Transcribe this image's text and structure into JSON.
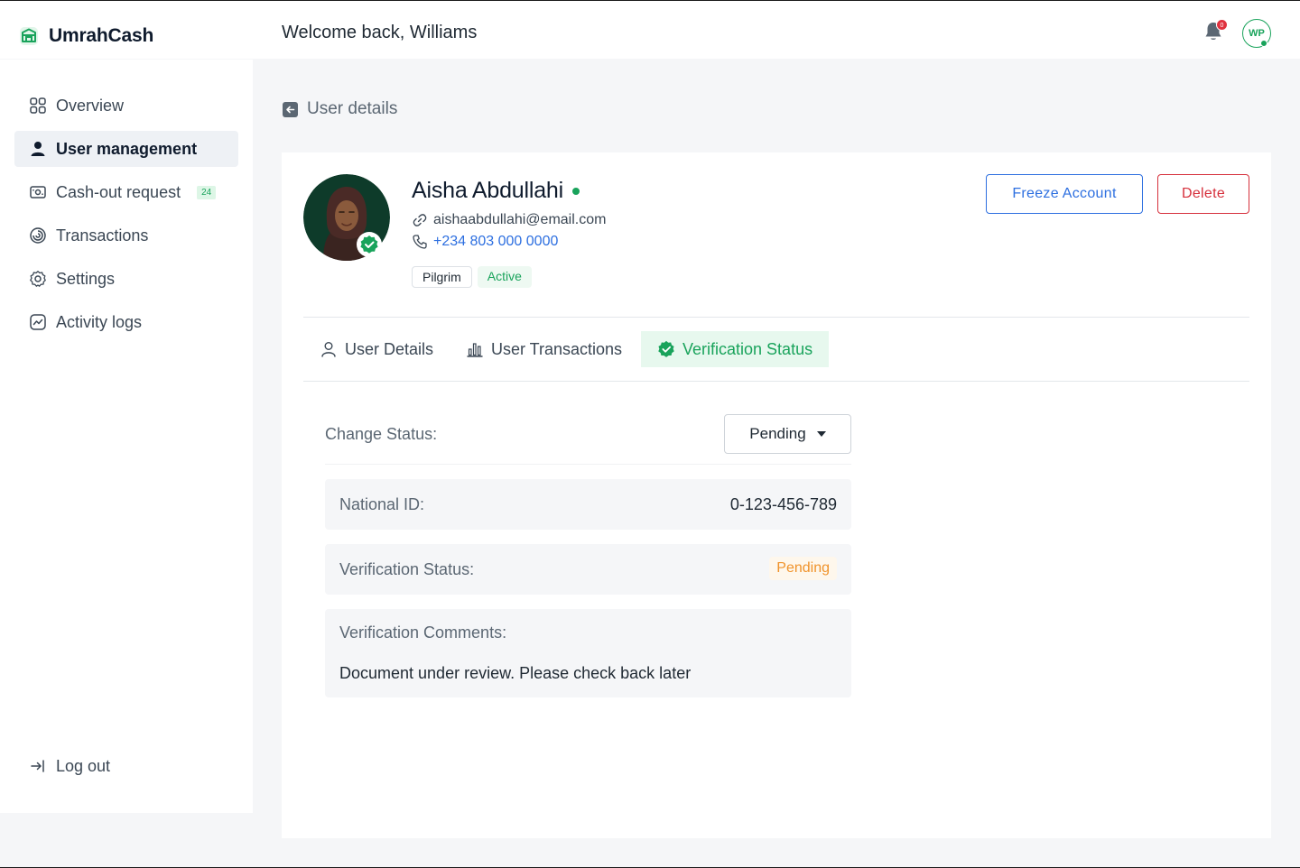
{
  "app": {
    "name": "UmrahCash"
  },
  "header": {
    "welcome": "Welcome back, Williams",
    "notification_count": "0",
    "user_initials": "WP"
  },
  "sidebar": {
    "items": [
      {
        "label": "Overview",
        "icon": "grid-icon",
        "active": false
      },
      {
        "label": "User management",
        "icon": "user-icon",
        "active": true
      },
      {
        "label": "Cash-out request",
        "icon": "cash-icon",
        "active": false,
        "badge": "24"
      },
      {
        "label": "Transactions",
        "icon": "transactions-icon",
        "active": false
      },
      {
        "label": "Settings",
        "icon": "gear-icon",
        "active": false
      },
      {
        "label": "Activity logs",
        "icon": "activity-icon",
        "active": false
      }
    ],
    "logout": "Log out"
  },
  "page": {
    "back_label": "User details"
  },
  "profile": {
    "name": "Aisha Abdullahi",
    "email": "aishaabdullahi@email.com",
    "phone": "+234 803 000 0000",
    "role": "Pilgrim",
    "account_status": "Active",
    "online": true
  },
  "actions": {
    "freeze": "Freeze Account",
    "delete": "Delete"
  },
  "tabs": [
    {
      "label": "User Details",
      "icon": "user-outline-icon",
      "active": false
    },
    {
      "label": "User Transactions",
      "icon": "bar-chart-icon",
      "active": false
    },
    {
      "label": "Verification Status",
      "icon": "verified-icon",
      "active": true
    }
  ],
  "verification": {
    "change_status_label": "Change Status:",
    "change_status_value": "Pending",
    "national_id_label": "National ID:",
    "national_id_value": "0-123-456-789",
    "status_label": "Verification Status:",
    "status_value": "Pending",
    "comments_label": "Verification Comments:",
    "comments_value": "Document under review. Please check back later"
  },
  "colors": {
    "brand_green": "#19A35B",
    "link_blue": "#2D6FE0",
    "danger_red": "#D6303C",
    "pending_orange": "#F0932B"
  }
}
